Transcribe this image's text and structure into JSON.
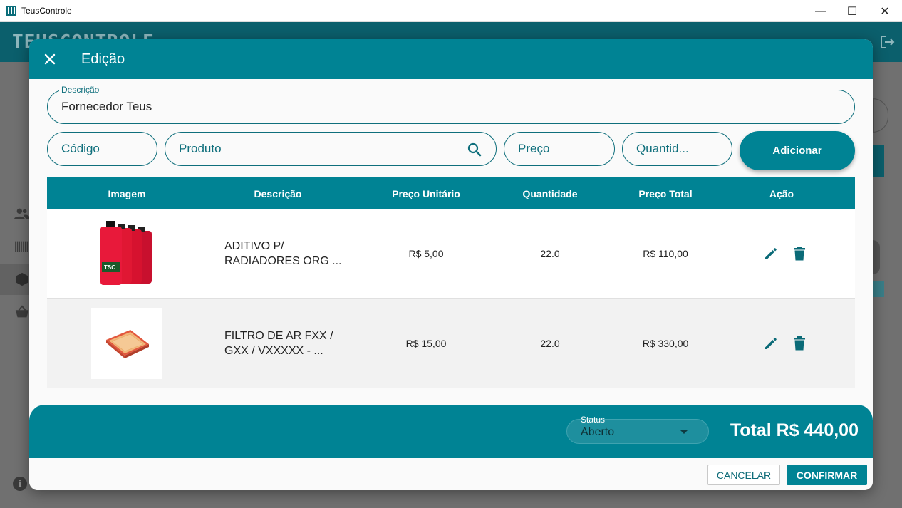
{
  "window": {
    "title": "TeusControle",
    "minimize": "—",
    "maximize": "☐",
    "close": "✕"
  },
  "background": {
    "logo": "TEUSCONTROLE"
  },
  "dialog": {
    "title": "Edição",
    "descricao": {
      "label": "Descrição",
      "value": "Fornecedor Teus"
    },
    "inputs": {
      "codigo_placeholder": "Código",
      "produto_placeholder": "Produto",
      "preco_placeholder": "Preço",
      "quantidade_placeholder": "Quantid..."
    },
    "add_button": "Adicionar",
    "table": {
      "headers": [
        "Imagem",
        "Descrição",
        "Preço Unitário",
        "Quantidade",
        "Preço Total",
        "Ação"
      ],
      "rows": [
        {
          "descricao_l1": "ADITIVO P/",
          "descricao_l2": "RADIADORES ORG ...",
          "preco_unitario": "R$ 5,00",
          "quantidade": "22.0",
          "preco_total": "R$ 110,00",
          "image": "coolant-bottles-image"
        },
        {
          "descricao_l1": "FILTRO DE AR FXX /",
          "descricao_l2": "GXX / VXXXXX - ...",
          "preco_unitario": "R$ 15,00",
          "quantidade": "22.0",
          "preco_total": "R$ 330,00",
          "image": "air-filter-image"
        }
      ]
    },
    "footer": {
      "status_label": "Status",
      "status_value": "Aberto",
      "total": "Total R$ 440,00"
    },
    "actions": {
      "cancel": "CANCELAR",
      "confirm": "CONFIRMAR"
    }
  },
  "colors": {
    "primary": "#008394",
    "dark_header": "#0b5f6c",
    "accent_text": "#0f6f7c"
  }
}
